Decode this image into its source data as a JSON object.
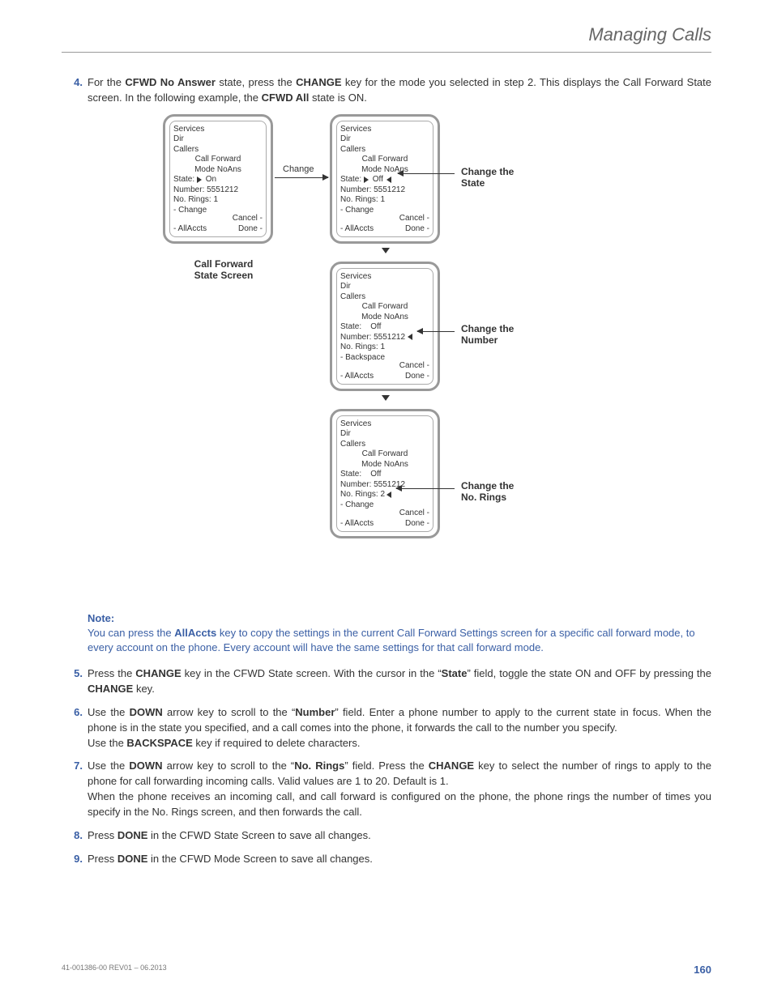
{
  "header": {
    "title": "Managing Calls"
  },
  "steps": {
    "s4": {
      "num": "4.",
      "pre": "For the ",
      "bold1": "CFWD No Answer",
      "mid1": " state, press the ",
      "bold2": "CHANGE",
      "mid2": " key for the mode you selected in step 2. This displays the Call Forward State screen. In the following example, the ",
      "bold3": "CFWD All",
      "post": " state is ON."
    },
    "s5": {
      "num": "5.",
      "pre": "Press the ",
      "bold1": "CHANGE",
      "mid1": " key in the CFWD State screen. With the cursor in the “",
      "bold2": "State",
      "mid2": "” field, toggle the state ON and OFF by pressing the ",
      "bold3": "CHANGE",
      "post": " key."
    },
    "s6": {
      "num": "6.",
      "pre": "Use the ",
      "bold1": "DOWN",
      "mid1": " arrow key to scroll to the “",
      "bold2": "Number",
      "mid2": "” field. Enter a phone number to apply to the current state in focus. When the phone is in the state you specified, and a call comes into the phone, it forwards the call to the number you specify.",
      "line2_pre": "Use the ",
      "line2_bold": "BACKSPACE",
      "line2_post": " key if required to delete characters."
    },
    "s7": {
      "num": "7.",
      "pre": "Use the ",
      "bold1": "DOWN",
      "mid1": " arrow key to scroll to the “",
      "bold2": "No. Rings",
      "mid2": "” field. Press the ",
      "bold3": "CHANGE",
      "mid3": " key to select the number of rings to apply to the phone for call forwarding incoming calls. Valid values are 1 to 20. Default is 1.",
      "line2": "When the phone receives an incoming call, and call forward is configured on the phone, the phone rings the number of times you specify in the No. Rings screen, and then forwards the call."
    },
    "s8": {
      "num": "8.",
      "pre": "Press ",
      "bold1": "DONE",
      "post": " in the CFWD State Screen to save all changes."
    },
    "s9": {
      "num": "9.",
      "pre": " Press ",
      "bold1": "DONE",
      "post": " in the CFWD Mode Screen to save all changes."
    }
  },
  "note": {
    "head": "Note:",
    "pre": "You can press the ",
    "bold": "AllAccts",
    "post": " key to copy the settings in the current Call Forward Settings screen for a specific call forward mode, to every account on the phone. Every account will have the same settings for that call forward mode."
  },
  "diagram": {
    "change_label": "Change",
    "caption_left": "Call Forward\nState Screen",
    "lbl_state": "Change the\nState",
    "lbl_number": "Change the\nNumber",
    "lbl_rings": "Change the\nNo. Rings",
    "screens": {
      "common": {
        "services": "Services",
        "dir": "Dir",
        "callers": "Callers",
        "cf": "Call Forward",
        "mode": "Mode NoAns",
        "number": "Number: 5551212",
        "rings1": "No. Rings: 1",
        "rings2": "No. Rings: 2",
        "change": "- Change",
        "backspace": "- Backspace",
        "cancel": "Cancel -",
        "allaccts": "- AllAccts",
        "done": "Done -",
        "state_on": "On",
        "state_off": "Off",
        "state_lbl": "State:"
      }
    }
  },
  "footer": {
    "left": "41-001386-00 REV01 – 06.2013",
    "page": "160"
  }
}
